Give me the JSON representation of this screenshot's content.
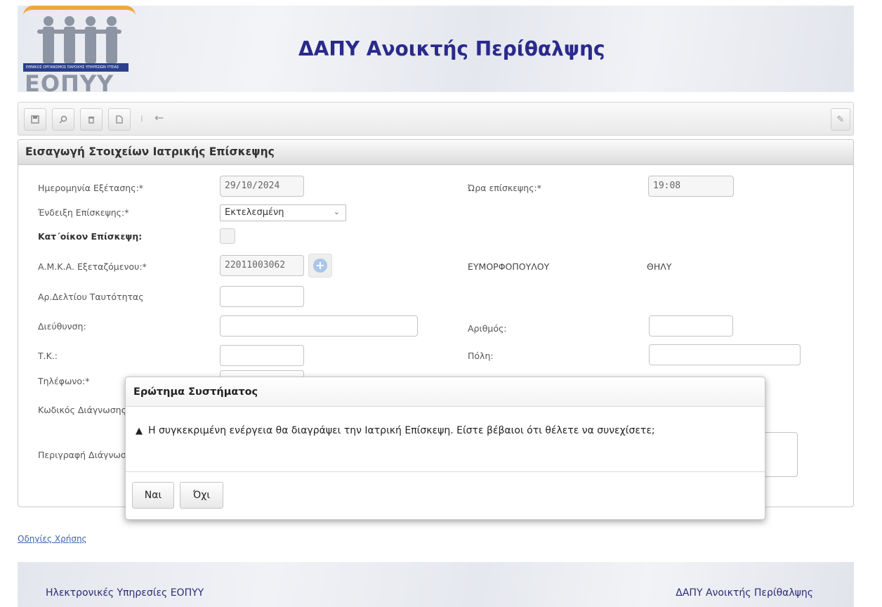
{
  "header": {
    "logo_strip": "ΕΘΝΙΚΟΣ ΟΡΓΑΝΙΣΜΟΣ ΠΑΡΟΧΗΣ ΥΠΗΡΕΣΙΩΝ ΥΓΕΙΑΣ",
    "logo_word": "ΕΟΠΥΥ",
    "title": "ΔΑΠΥ Ανοικτής Περίθαλψης"
  },
  "toolbar": {
    "icons": [
      "save-icon",
      "search-icon",
      "trash-icon",
      "new-document-icon",
      "back-arrow-icon",
      "edit-pencil-icon"
    ]
  },
  "panel": {
    "title": "Εισαγωγή Στοιχείων Ιατρικής Επίσκεψης",
    "fields": {
      "exam_date_label": "Ημερομηνία Εξέτασης:*",
      "exam_date_value": "29/10/2024",
      "visit_time_label": "Ώρα επίσκεψης:*",
      "visit_time_value": "19:08",
      "visit_type_label": "Ένδειξη Επίσκεψης:*",
      "visit_type_value": "Εκτελεσμένη",
      "home_visit_label": "Κατ΄οίκον Επίσκεψη:",
      "amka_label": "Α.Μ.Κ.Α. Εξεταζόμενου:*",
      "amka_value": "22011003062",
      "patient_surname": "ΕΥΜΟΡΦΟΠΟΥΛΟΥ",
      "patient_sex": "ΘΗΛΥ",
      "id_card_label": "Αρ.Δελτίου Ταυτότητας",
      "address_label": "Διεύθυνση:",
      "number_label": "Αριθμός:",
      "zip_label": "Τ.Κ.:",
      "city_label": "Πόλη:",
      "phone_label": "Τηλέφωνο:*",
      "diag_code_label": "Κωδικός Διάγνωσης",
      "diag_desc_label": "Περιγραφή Διάγνωσ"
    }
  },
  "help_link": "Οδηγίες Χρήσης",
  "footer": {
    "left": "Ηλεκτρονικές Υπηρεσίες ΕΟΠΥΥ",
    "right": "ΔΑΠΥ Ανοικτής Περίθαλψης"
  },
  "dialog": {
    "title": "Ερώτημα Συστήματος",
    "message": "Η συγκεκριμένη ενέργεια θα διαγράψει την Ιατρική Επίσκεψη. Είστε βέβαιοι ότι θέλετε να συνεχίσετε;",
    "yes_label": "Ναι",
    "no_label": "Όχι"
  },
  "colors": {
    "title": "#2a2a8c",
    "link": "#3a64b4",
    "logo_orange": "#f0a640",
    "logo_blue": "#2b3f8c"
  }
}
